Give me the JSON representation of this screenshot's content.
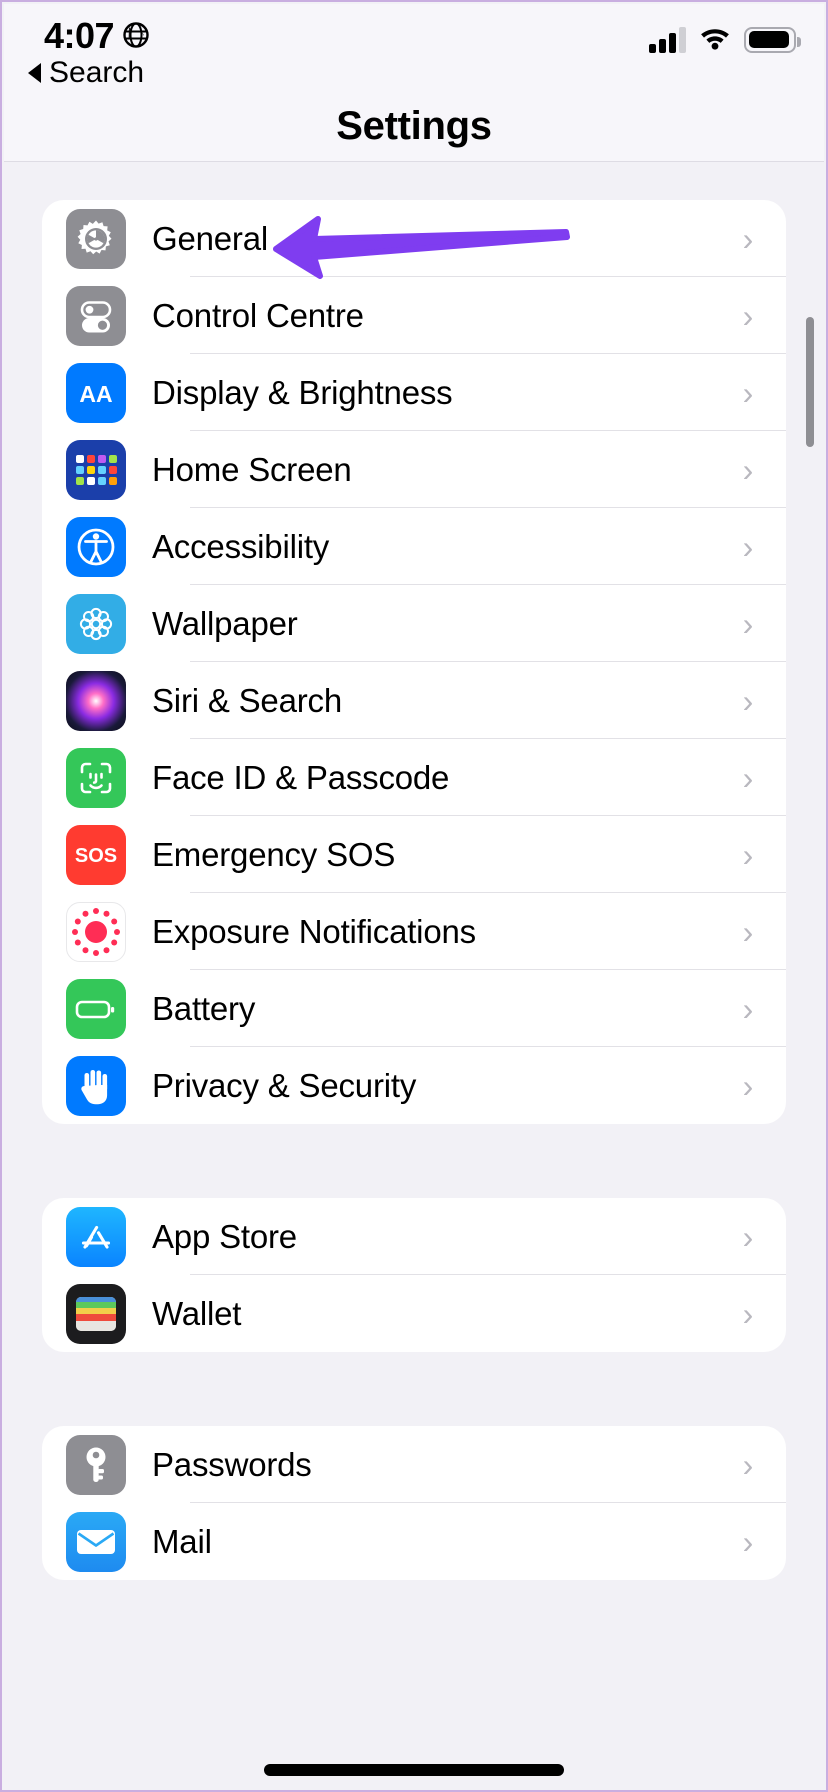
{
  "statusbar": {
    "time": "4:07",
    "location_icon": "location-globe-icon",
    "cellular_icon": "cellular-signal-icon",
    "wifi_icon": "wifi-icon",
    "battery_icon": "battery-icon"
  },
  "nav": {
    "back_label": "Search",
    "title": "Settings"
  },
  "annotation": {
    "type": "arrow",
    "direction": "left",
    "color": "#7f3df0",
    "points_at": "General"
  },
  "groups": [
    {
      "id": "system-group",
      "rows": [
        {
          "label": "General",
          "icon": "gear-icon",
          "chevron": "›"
        },
        {
          "label": "Control Centre",
          "icon": "toggles-icon",
          "chevron": "›"
        },
        {
          "label": "Display & Brightness",
          "icon": "aa-text-size-icon",
          "chevron": "›"
        },
        {
          "label": "Home Screen",
          "icon": "home-screen-grid-icon",
          "chevron": "›"
        },
        {
          "label": "Accessibility",
          "icon": "accessibility-icon",
          "chevron": "›"
        },
        {
          "label": "Wallpaper",
          "icon": "wallpaper-flower-icon",
          "chevron": "›"
        },
        {
          "label": "Siri & Search",
          "icon": "siri-orb-icon",
          "chevron": "›"
        },
        {
          "label": "Face ID & Passcode",
          "icon": "face-id-icon",
          "chevron": "›"
        },
        {
          "label": "Emergency SOS",
          "icon": "sos-icon",
          "chevron": "›"
        },
        {
          "label": "Exposure Notifications",
          "icon": "exposure-dots-icon",
          "chevron": "›"
        },
        {
          "label": "Battery",
          "icon": "battery-app-icon",
          "chevron": "›"
        },
        {
          "label": "Privacy & Security",
          "icon": "privacy-hand-icon",
          "chevron": "›"
        }
      ]
    },
    {
      "id": "store-group",
      "rows": [
        {
          "label": "App Store",
          "icon": "app-store-icon",
          "chevron": "›"
        },
        {
          "label": "Wallet",
          "icon": "wallet-icon",
          "chevron": "›"
        }
      ]
    },
    {
      "id": "accounts-group",
      "rows": [
        {
          "label": "Passwords",
          "icon": "key-icon",
          "chevron": "›"
        },
        {
          "label": "Mail",
          "icon": "mail-icon",
          "chevron": "›"
        }
      ]
    }
  ],
  "colors": {
    "background": "#f2f1f6",
    "card": "#ffffff",
    "separator": "#e2e1e6",
    "chevron": "#b9b8bf",
    "accent_annotation": "#7f3df0",
    "icon_gray": "#8e8e93",
    "icon_blue": "#007aff",
    "icon_green": "#34c759",
    "icon_red": "#ff3b30",
    "icon_teal": "#32ade6"
  }
}
